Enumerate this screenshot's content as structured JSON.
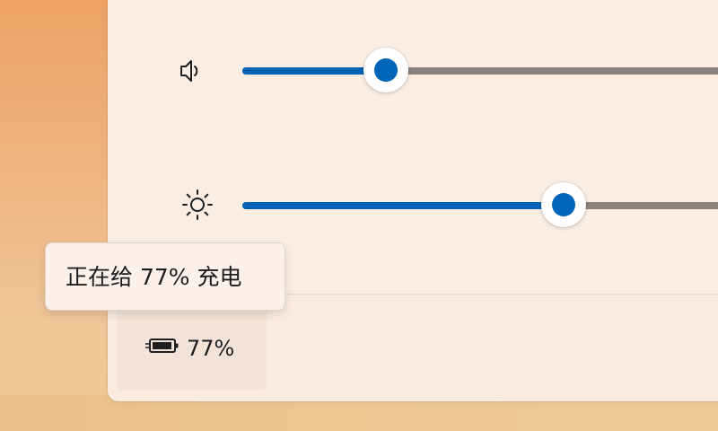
{
  "quick_settings": {
    "volume": {
      "icon": "speaker-icon",
      "level": 0.29
    },
    "brightness": {
      "icon": "brightness-sun-icon",
      "level": 0.65
    },
    "battery": {
      "icon": "battery-charging-icon",
      "percent_label": "77%",
      "tooltip": "正在给 77% 充电"
    }
  },
  "colors": {
    "accent": "#0062b6",
    "rail": "#8b827d",
    "panel_background": "#fbede2"
  }
}
